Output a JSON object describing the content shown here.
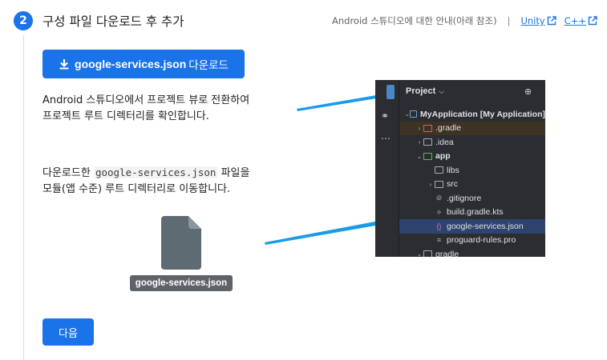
{
  "step": {
    "number": "2",
    "title": "구성 파일 다운로드 후 추가"
  },
  "help": {
    "text": "Android 스튜디오에 대한 안내(아래 참조)",
    "separator": "|",
    "links": [
      "Unity",
      "C++"
    ]
  },
  "download_button": {
    "file": "google-services.json",
    "suffix": "다운로드"
  },
  "instructions": {
    "p1_line1": "Android 스튜디오에서 프로젝트 뷰로 전환하여",
    "p1_line2": "프로젝트 루트 디렉터리를 확인합니다.",
    "p2_prefix": "다운로드한 ",
    "p2_code": "google-services.json",
    "p2_suffix": " 파일을",
    "p2_line2": "모듈(앱 수준) 루트 디렉터리로 이동합니다."
  },
  "file_label": "google-services.json",
  "next_button": "다음",
  "ide": {
    "header": "Project",
    "tree": [
      {
        "label": "MyApplication [My Application]",
        "level": 0,
        "arrow": "down",
        "icon": "module-folder-icon"
      },
      {
        "label": ".gradle",
        "level": 1,
        "arrow": "right",
        "icon": "folder-icon"
      },
      {
        "label": ".idea",
        "level": 1,
        "arrow": "right",
        "icon": "folder-icon"
      },
      {
        "label": "app",
        "level": 1,
        "arrow": "down",
        "icon": "module-folder-icon"
      },
      {
        "label": "libs",
        "level": 2,
        "arrow": "",
        "icon": "folder-icon"
      },
      {
        "label": "src",
        "level": 2,
        "arrow": "right",
        "icon": "folder-icon"
      },
      {
        "label": ".gitignore",
        "level": 2,
        "arrow": "",
        "icon": "ignore-file-icon"
      },
      {
        "label": "build.gradle.kts",
        "level": 2,
        "arrow": "",
        "icon": "gradle-file-icon"
      },
      {
        "label": "google-services.json",
        "level": 2,
        "arrow": "",
        "icon": "json-file-icon"
      },
      {
        "label": "proguard-rules.pro",
        "level": 2,
        "arrow": "",
        "icon": "text-file-icon"
      },
      {
        "label": "gradle",
        "level": 1,
        "arrow": "down",
        "icon": "folder-icon"
      }
    ]
  },
  "colors": {
    "primary": "#1a73e8",
    "ide_bg": "#2b2d30",
    "arrow": "#1a9be8"
  }
}
